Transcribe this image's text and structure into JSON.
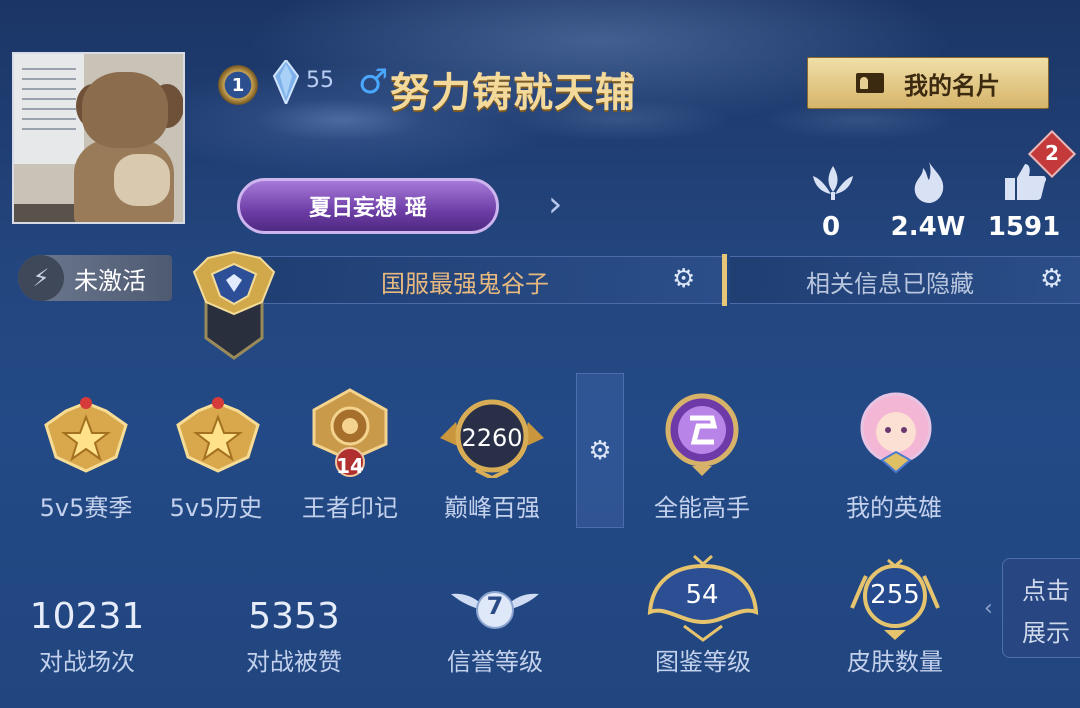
{
  "profile": {
    "level_badge": "1",
    "star_level": "55",
    "gender_symbol": "♂",
    "name": "努力铸就天辅",
    "card_button": "我的名片",
    "title_plate": "夏日妄想 瑶"
  },
  "stats": [
    {
      "icon": "lotus-icon",
      "value": "0"
    },
    {
      "icon": "flame-icon",
      "value": "2.4W"
    },
    {
      "icon": "thumbs-up-icon",
      "value": "1591",
      "badge": "2"
    }
  ],
  "bar": {
    "inactive_label": "未激活",
    "title_text": "国服最强鬼谷子",
    "hidden_text": "相关信息已隐藏"
  },
  "emblems": [
    {
      "label": "5v5赛季"
    },
    {
      "label": "5v5历史"
    },
    {
      "label": "王者印记",
      "number": "14"
    },
    {
      "label": "巅峰百强",
      "number": "2260"
    },
    {
      "label": "全能高手"
    },
    {
      "label": "我的英雄"
    }
  ],
  "bottom": [
    {
      "value": "10231",
      "label": "对战场次"
    },
    {
      "value": "5353",
      "label": "对战被赞"
    },
    {
      "value": "7",
      "label": "信誉等级"
    },
    {
      "value": "54",
      "label": "图鉴等级"
    },
    {
      "value": "255",
      "label": "皮肤数量"
    }
  ],
  "side_tab": {
    "line1": "点击",
    "line2": "展示"
  },
  "colors": {
    "name_gold": "#f3d99a",
    "title_orange": "#e8b97f",
    "bg_blue": "#23457d",
    "badge_red": "#c43a3a"
  }
}
